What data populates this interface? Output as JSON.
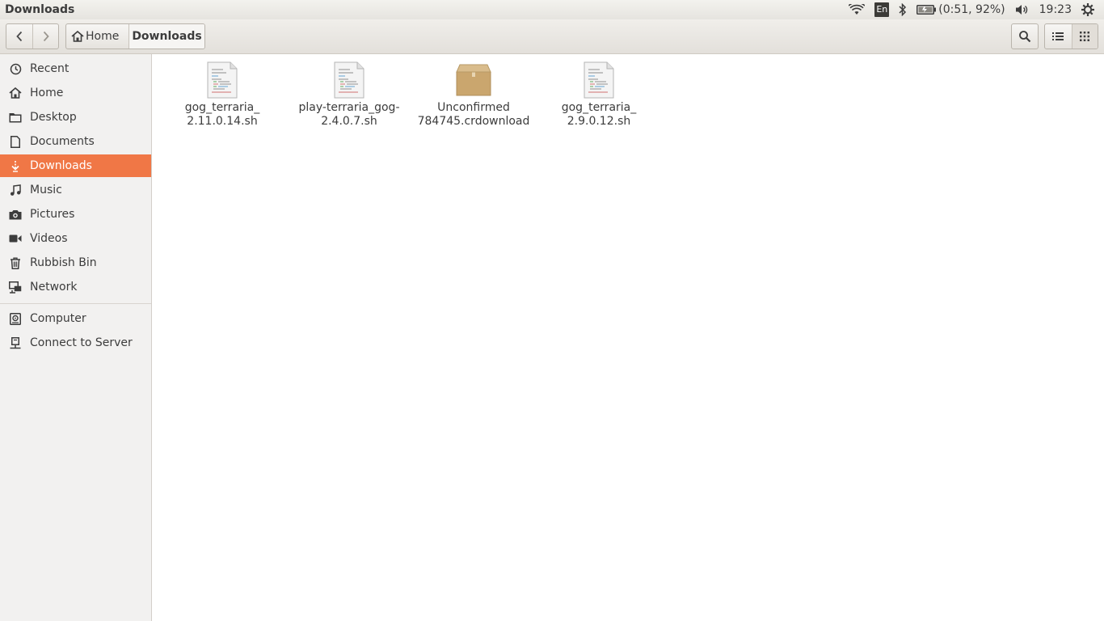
{
  "window": {
    "title": "Downloads"
  },
  "panel": {
    "language": "En",
    "battery": "(0:51, 92%)",
    "clock": "19:23",
    "icons": [
      "wifi-icon",
      "keyboard-layout-indicator",
      "bluetooth-icon",
      "battery-icon",
      "volume-icon",
      "session-gear-icon"
    ]
  },
  "toolbar": {
    "path": {
      "home_label": "Home",
      "current_label": "Downloads"
    }
  },
  "sidebar": {
    "items": [
      {
        "label": "Recent",
        "icon": "clock-icon"
      },
      {
        "label": "Home",
        "icon": "home-icon"
      },
      {
        "label": "Desktop",
        "icon": "folder-icon"
      },
      {
        "label": "Documents",
        "icon": "document-icon"
      },
      {
        "label": "Downloads",
        "icon": "download-icon",
        "active": true
      },
      {
        "label": "Music",
        "icon": "music-icon"
      },
      {
        "label": "Pictures",
        "icon": "camera-icon"
      },
      {
        "label": "Videos",
        "icon": "video-icon"
      },
      {
        "label": "Rubbish Bin",
        "icon": "trash-icon"
      },
      {
        "label": "Network",
        "icon": "network-icon"
      }
    ],
    "devices": [
      {
        "label": "Computer",
        "icon": "computer-icon"
      },
      {
        "label": "Connect to Server",
        "icon": "server-icon"
      }
    ]
  },
  "files": [
    {
      "name": "gog_terraria_\n2.11.0.14.sh",
      "icon": "script-file-icon"
    },
    {
      "name": "play-terraria_gog-\n2.4.0.7.sh",
      "icon": "script-file-icon"
    },
    {
      "name": "Unconfirmed\n784745.crdownload",
      "icon": "package-icon"
    },
    {
      "name": "gog_terraria_\n2.9.0.12.sh",
      "icon": "script-file-icon"
    }
  ],
  "colors": {
    "accent": "#f07746",
    "panel_bg": "#e6e4df",
    "sidebar_bg": "#f2f1f0"
  }
}
